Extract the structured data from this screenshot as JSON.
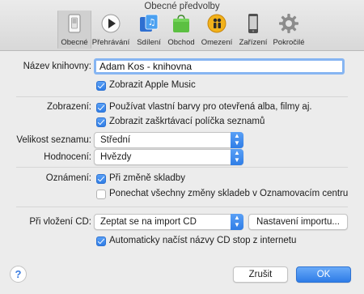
{
  "window": {
    "title": "Obecné předvolby"
  },
  "toolbar": {
    "items": [
      {
        "label": "Obecné",
        "icon": "switch-icon"
      },
      {
        "label": "Přehrávání",
        "icon": "play-icon"
      },
      {
        "label": "Sdílení",
        "icon": "sharing-icon"
      },
      {
        "label": "Obchod",
        "icon": "store-icon"
      },
      {
        "label": "Omezení",
        "icon": "restrictions-icon"
      },
      {
        "label": "Zařízení",
        "icon": "device-icon"
      },
      {
        "label": "Pokročilé",
        "icon": "gear-icon"
      }
    ],
    "selected": "Obecné"
  },
  "library": {
    "label": "Název knihovny:",
    "value": "Adam Kos - knihovna",
    "apple_music": {
      "label": "Zobrazit Apple Music",
      "checked": true
    }
  },
  "view": {
    "label": "Zobrazení:",
    "custom_colors": {
      "label": "Používat vlastní barvy pro otevřená alba, filmy aj.",
      "checked": true
    },
    "list_checkboxes": {
      "label": "Zobrazit zaškrtávací políčka seznamů",
      "checked": true
    }
  },
  "list_size": {
    "label": "Velikost seznamu:",
    "value": "Střední"
  },
  "rating": {
    "label": "Hodnocení:",
    "value": "Hvězdy"
  },
  "notifications": {
    "label": "Oznámení:",
    "song_change": {
      "label": "Při změně skladby",
      "checked": true
    },
    "keep_all": {
      "label": "Ponechat všechny změny skladeb v Oznamovacím centru",
      "checked": false
    }
  },
  "cd": {
    "label": "Při vložení CD:",
    "value": "Zeptat se na import CD",
    "import_settings_label": "Nastavení importu...",
    "auto_names": {
      "label": "Automaticky načíst názvy CD stop z internetu",
      "checked": true
    }
  },
  "footer": {
    "help_label": "?",
    "cancel_label": "Zrušit",
    "ok_label": "OK"
  },
  "colors": {
    "accent": "#2f7de6",
    "focus_ring": "#86b5f2"
  }
}
